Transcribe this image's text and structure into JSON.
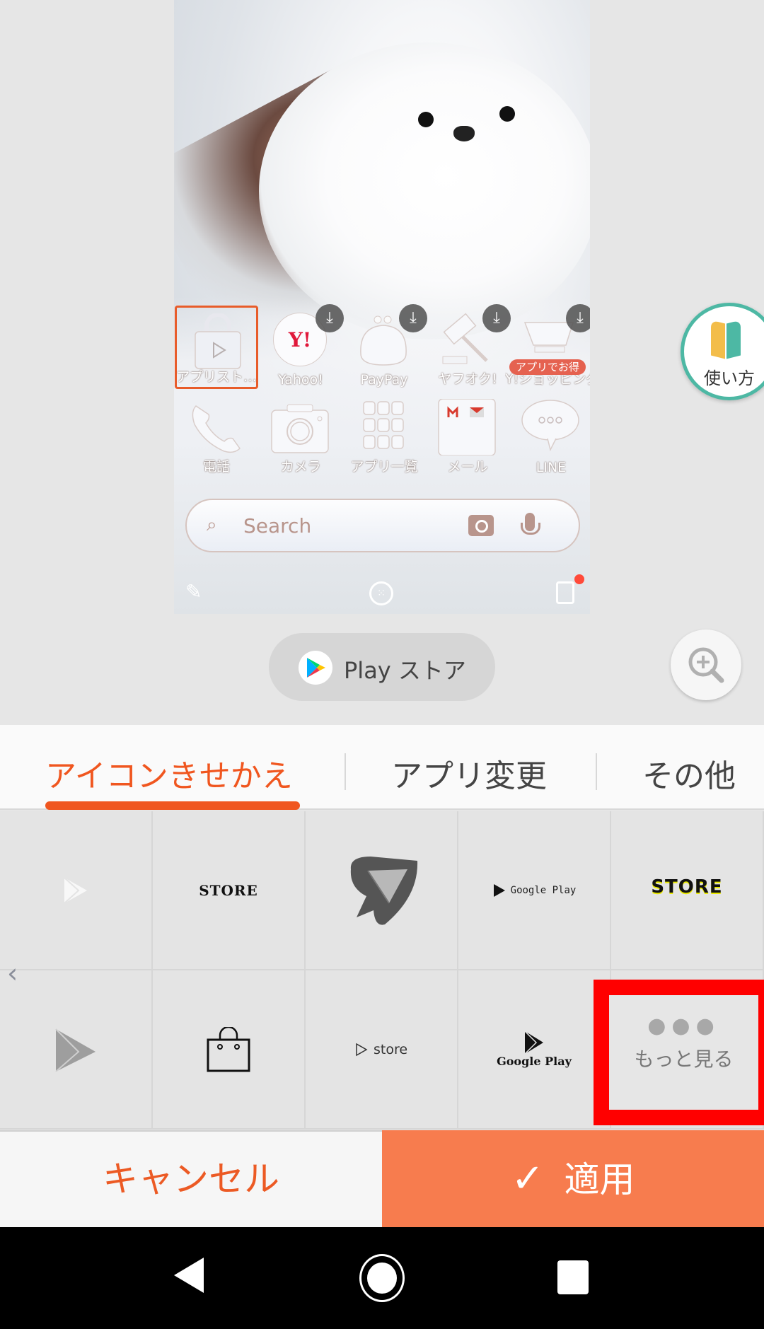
{
  "preview": {
    "apps_row1": [
      {
        "label": "アプリスト…",
        "icon": "app-store-bag-icon",
        "selected": true,
        "download": false
      },
      {
        "label": "Yahoo!",
        "icon": "yahoo-icon",
        "download": true
      },
      {
        "label": "PayPay",
        "icon": "purse-icon",
        "download": true
      },
      {
        "label": "ヤフオク!",
        "icon": "auction-hammer-icon",
        "download": true
      },
      {
        "label": "Y!ショッピング",
        "icon": "shopping-cart-icon",
        "download": true
      }
    ],
    "promo_badge": "アプリでお得",
    "apps_row2": [
      {
        "label": "電話",
        "icon": "phone-icon"
      },
      {
        "label": "カメラ",
        "icon": "camera-icon"
      },
      {
        "label": "アプリ一覧",
        "icon": "app-drawer-icon"
      },
      {
        "label": "メール",
        "icon": "mail-icon"
      },
      {
        "label": "LINE",
        "icon": "line-chat-icon"
      }
    ],
    "search_placeholder": "Search",
    "yahoo_mark": "Y!",
    "download_glyph": "⤓",
    "dock": {
      "left": "paint-icon",
      "center": "apps-icon",
      "right": "home-edit-icon"
    }
  },
  "guide_button": {
    "label": "使い方"
  },
  "selected_app_chip": {
    "label": "Play ストア"
  },
  "tabs": [
    {
      "label": "アイコンきせかえ",
      "active": true
    },
    {
      "label": "アプリ変更",
      "active": false
    },
    {
      "label": "その他",
      "active": false
    }
  ],
  "icon_options": {
    "row1": [
      {
        "type": "play-white"
      },
      {
        "type": "text-serif",
        "text": "STORE"
      },
      {
        "type": "spade-paper-plane"
      },
      {
        "type": "play-text",
        "text": "Google Play"
      },
      {
        "type": "text-bold-drip",
        "text": "STORE"
      }
    ],
    "row2": [
      {
        "type": "play-gray"
      },
      {
        "type": "shopping-bag"
      },
      {
        "type": "play-outline-text",
        "text": "store"
      },
      {
        "type": "play-stacked-text",
        "text": "Google Play"
      }
    ],
    "more": {
      "dots": "●●●",
      "label": "もっと見る"
    }
  },
  "actions": {
    "cancel": "キャンセル",
    "apply": "適用",
    "apply_check": "✓"
  },
  "colors": {
    "accent": "#f0561f",
    "apply_bg": "#f77c4e",
    "highlight": "#ff0000",
    "guide_teal": "#4db8a4"
  }
}
